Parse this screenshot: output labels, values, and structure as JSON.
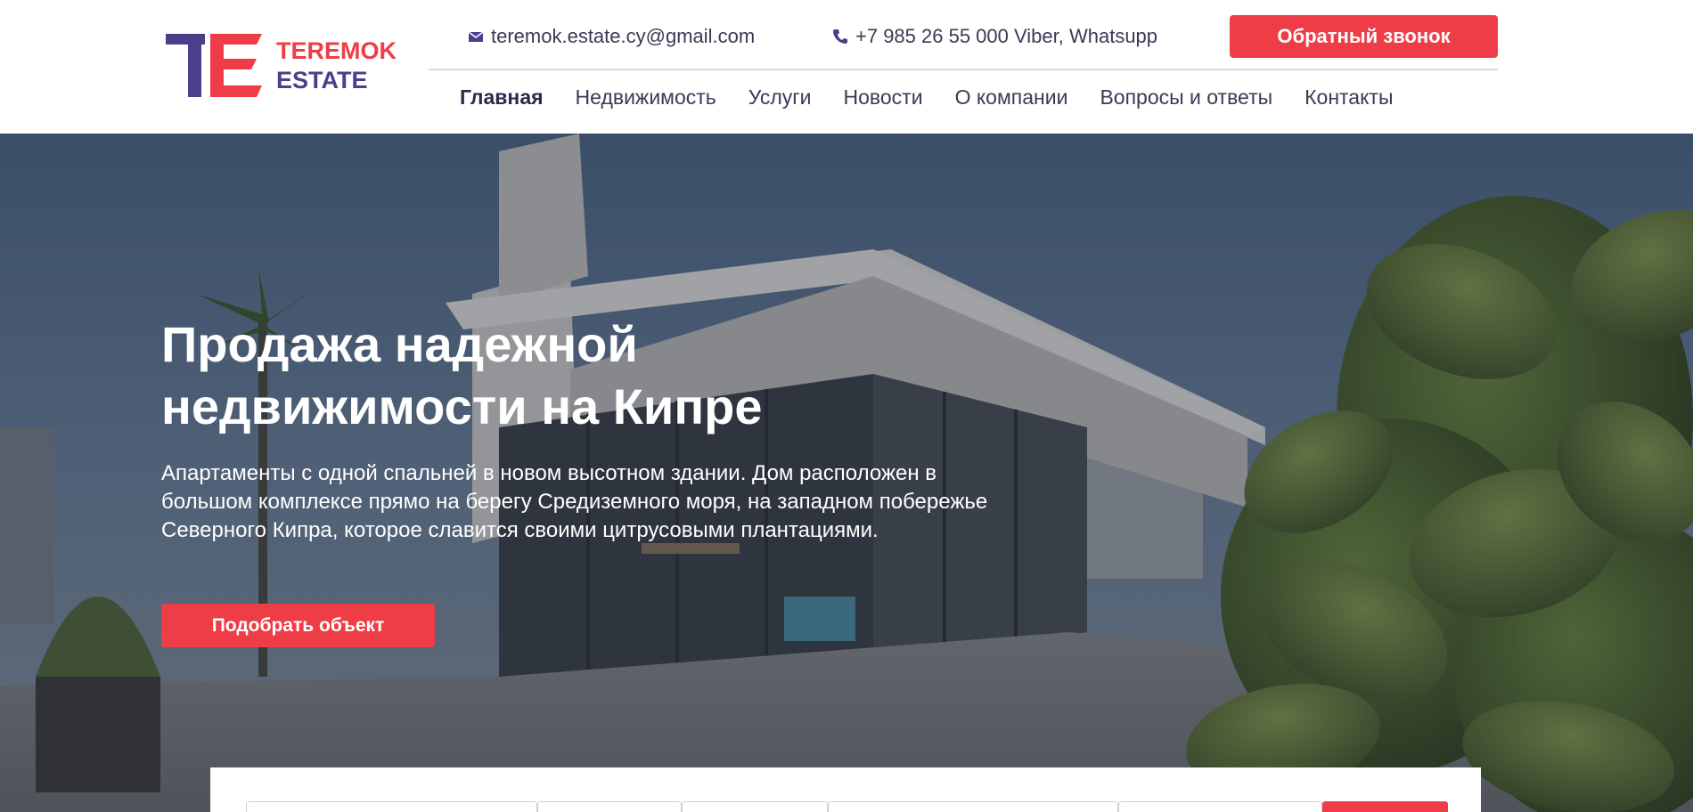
{
  "brand": {
    "line1": "TEREMOK",
    "line2": "ESTATE",
    "colors": {
      "primary": "#4b3f8c",
      "accent": "#ee3d46"
    }
  },
  "topbar": {
    "email": "teremok.estate.cy@gmail.com",
    "email_icon": "envelope-icon",
    "phone": "+7 985 26 55 000 Viber, Whatsupp",
    "phone_icon": "phone-icon",
    "callback_label": "Обратный звонок"
  },
  "nav": {
    "items": [
      {
        "label": "Главная",
        "active": true
      },
      {
        "label": "Недвижимость"
      },
      {
        "label": "Услуги"
      },
      {
        "label": "Новости"
      },
      {
        "label": "О компании"
      },
      {
        "label": "Вопросы и ответы"
      },
      {
        "label": "Контакты"
      }
    ]
  },
  "hero": {
    "title_line1": "Продажа надежной",
    "title_line2": "недвижимости на Кипре",
    "text": "Апартаменты с одной спальней в новом высотном здании. Дом расположен в большом комплексе прямо на берегу Средиземного моря, на западном побережье Северного Кипра, которое славится своими цитрусовыми плантациями.",
    "button_label": "Подобрать объект"
  }
}
